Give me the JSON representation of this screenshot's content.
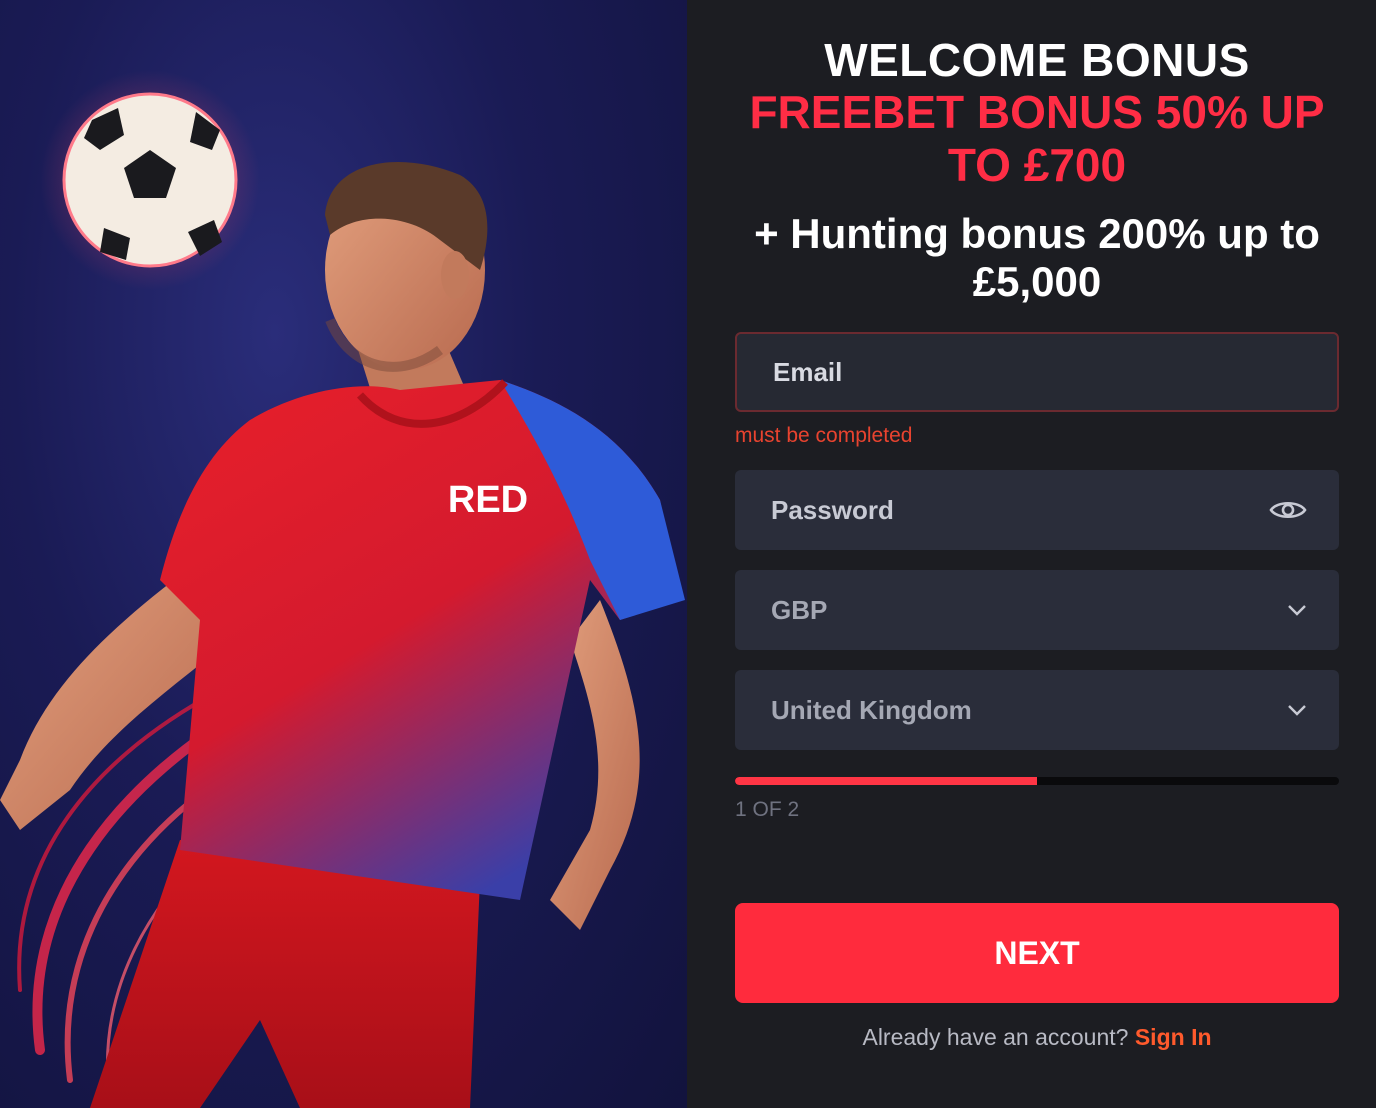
{
  "hero": {
    "shirt_text": "RED",
    "colors": {
      "background": "#1a1b55",
      "shirt_red": "#e8202a",
      "sleeve_blue": "#2e5bd8"
    }
  },
  "promo": {
    "title": "WELCOME BONUS",
    "offer": "FREEBET BONUS 50% UP TO £700",
    "extra": "+ Hunting bonus 200% up to £5,000"
  },
  "form": {
    "email": {
      "placeholder": "Email",
      "error": "must be completed"
    },
    "password": {
      "placeholder": "Password",
      "toggle_icon": "eye-icon"
    },
    "currency": {
      "value": "GBP",
      "icon": "chevron-down-icon"
    },
    "country": {
      "value": "United Kingdom",
      "icon": "chevron-down-icon"
    },
    "progress": {
      "step_text": "1 OF 2",
      "fraction": 0.5
    },
    "next_label": "NEXT",
    "signin_prompt": "Already have an account?",
    "signin_label": "Sign In"
  },
  "colors": {
    "accent": "#ff2b3d",
    "offer_red": "#ff2d45",
    "error": "#e8432f",
    "link": "#ff5a2c",
    "panel_bg": "#1c1d22",
    "field_bg": "#2a2d3a"
  }
}
